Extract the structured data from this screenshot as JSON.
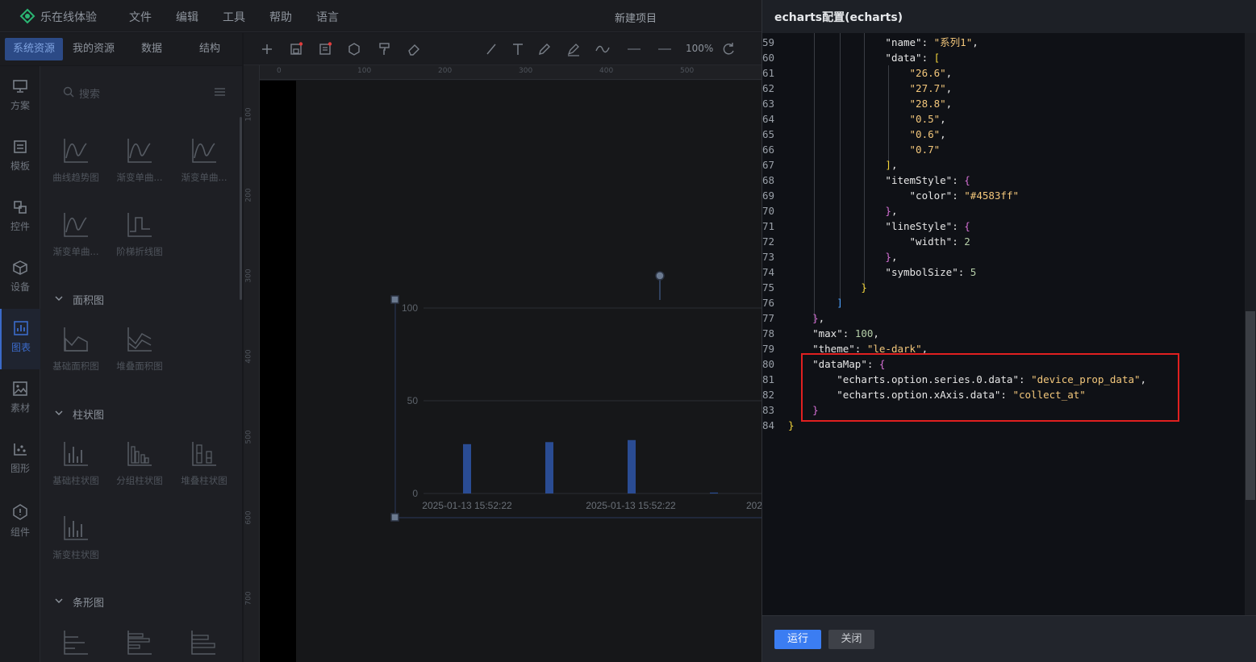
{
  "app": {
    "brand": "乐在线体验",
    "menu": [
      "文件",
      "编辑",
      "工具",
      "帮助",
      "语言"
    ],
    "project_title": "新建项目"
  },
  "left_tabs": [
    {
      "label": "系统资源",
      "active": true
    },
    {
      "label": "我的资源",
      "active": false
    },
    {
      "label": "数据",
      "active": false
    },
    {
      "label": "结构",
      "active": false
    }
  ],
  "rail": [
    {
      "label": "方案",
      "icon": "monitor-icon"
    },
    {
      "label": "模板",
      "icon": "template-icon"
    },
    {
      "label": "控件",
      "icon": "widget-icon"
    },
    {
      "label": "设备",
      "icon": "cube-icon"
    },
    {
      "label": "图表",
      "icon": "chart-icon",
      "active": true
    },
    {
      "label": "素材",
      "icon": "image-icon"
    },
    {
      "label": "图形",
      "icon": "shapes-icon"
    },
    {
      "label": "组件",
      "icon": "component-icon"
    }
  ],
  "library": {
    "search_placeholder": "搜索",
    "line_items": [
      "曲线趋势图",
      "渐变单曲...",
      "渐变单曲...",
      "渐变单曲...",
      "阶梯折线图"
    ],
    "sections": {
      "area": "面积图",
      "bar": "柱状图",
      "hbar": "条形图"
    },
    "area_items": [
      "基础面积图",
      "堆叠面积图"
    ],
    "bar_items": [
      "基础柱状图",
      "分组柱状图",
      "堆叠柱状图",
      "渐变柱状图"
    ]
  },
  "canvas_toolbar": {
    "zoom": "100%"
  },
  "rulers": {
    "h": [
      "0",
      "100",
      "200",
      "300",
      "400",
      "500"
    ],
    "v": [
      "100",
      "200",
      "300",
      "400",
      "500",
      "600",
      "700"
    ]
  },
  "chart_data": {
    "type": "bar",
    "categories": [
      "2025-01-13 15:52:22",
      "2025-01-13 15:52:22",
      "202"
    ],
    "values": [
      26.6,
      27.7,
      28.8,
      0.5
    ],
    "ylim": [
      0,
      100
    ],
    "y_ticks": [
      "100",
      "50",
      "0"
    ],
    "color": "#4583ff"
  },
  "panel": {
    "title": "echarts配置(echarts)",
    "run_label": "运行",
    "close_label": "关闭"
  },
  "code_lines": [
    {
      "n": "59",
      "ind": 4,
      "t": [
        [
          "k",
          "\"name\""
        ],
        [
          "c",
          ": "
        ],
        [
          "s",
          "\"系列1\""
        ],
        [
          "c",
          ","
        ]
      ]
    },
    {
      "n": "60",
      "ind": 4,
      "t": [
        [
          "k",
          "\"data\""
        ],
        [
          "c",
          ": "
        ],
        [
          "p1",
          "["
        ]
      ]
    },
    {
      "n": "61",
      "ind": 5,
      "t": [
        [
          "s",
          "\"26.6\""
        ],
        [
          "c",
          ","
        ]
      ]
    },
    {
      "n": "62",
      "ind": 5,
      "t": [
        [
          "s",
          "\"27.7\""
        ],
        [
          "c",
          ","
        ]
      ]
    },
    {
      "n": "63",
      "ind": 5,
      "t": [
        [
          "s",
          "\"28.8\""
        ],
        [
          "c",
          ","
        ]
      ]
    },
    {
      "n": "64",
      "ind": 5,
      "t": [
        [
          "s",
          "\"0.5\""
        ],
        [
          "c",
          ","
        ]
      ]
    },
    {
      "n": "65",
      "ind": 5,
      "t": [
        [
          "s",
          "\"0.6\""
        ],
        [
          "c",
          ","
        ]
      ]
    },
    {
      "n": "66",
      "ind": 5,
      "t": [
        [
          "s",
          "\"0.7\""
        ]
      ]
    },
    {
      "n": "67",
      "ind": 4,
      "t": [
        [
          "p1",
          "]"
        ],
        [
          "c",
          ","
        ]
      ]
    },
    {
      "n": "68",
      "ind": 4,
      "t": [
        [
          "k",
          "\"itemStyle\""
        ],
        [
          "c",
          ": "
        ],
        [
          "p2",
          "{"
        ]
      ]
    },
    {
      "n": "69",
      "ind": 5,
      "t": [
        [
          "k",
          "\"color\""
        ],
        [
          "c",
          ": "
        ],
        [
          "s",
          "\"#4583ff\""
        ]
      ]
    },
    {
      "n": "70",
      "ind": 4,
      "t": [
        [
          "p2",
          "}"
        ],
        [
          "c",
          ","
        ]
      ]
    },
    {
      "n": "71",
      "ind": 4,
      "t": [
        [
          "k",
          "\"lineStyle\""
        ],
        [
          "c",
          ": "
        ],
        [
          "p2",
          "{"
        ]
      ]
    },
    {
      "n": "72",
      "ind": 5,
      "t": [
        [
          "k",
          "\"width\""
        ],
        [
          "c",
          ": "
        ],
        [
          "n",
          "2"
        ]
      ]
    },
    {
      "n": "73",
      "ind": 4,
      "t": [
        [
          "p2",
          "}"
        ],
        [
          "c",
          ","
        ]
      ]
    },
    {
      "n": "74",
      "ind": 4,
      "t": [
        [
          "k",
          "\"symbolSize\""
        ],
        [
          "c",
          ": "
        ],
        [
          "n",
          "5"
        ]
      ]
    },
    {
      "n": "75",
      "ind": 3,
      "t": [
        [
          "p1",
          "}"
        ]
      ]
    },
    {
      "n": "76",
      "ind": 2,
      "t": [
        [
          "p3",
          "]"
        ]
      ]
    },
    {
      "n": "77",
      "ind": 1,
      "t": [
        [
          "p2",
          "}"
        ],
        [
          "c",
          ","
        ]
      ]
    },
    {
      "n": "78",
      "ind": 1,
      "t": [
        [
          "k",
          "\"max\""
        ],
        [
          "c",
          ": "
        ],
        [
          "n",
          "100"
        ],
        [
          "c",
          ","
        ]
      ]
    },
    {
      "n": "79",
      "ind": 1,
      "t": [
        [
          "k",
          "\"theme\""
        ],
        [
          "c",
          ": "
        ],
        [
          "s",
          "\"le-dark\""
        ],
        [
          "c",
          ","
        ]
      ]
    },
    {
      "n": "80",
      "ind": 1,
      "t": [
        [
          "k",
          "\"dataMap\""
        ],
        [
          "c",
          ": "
        ],
        [
          "p2",
          "{"
        ]
      ]
    },
    {
      "n": "81",
      "ind": 2,
      "t": [
        [
          "k",
          "\"echarts.option.series.0.data\""
        ],
        [
          "c",
          ": "
        ],
        [
          "s",
          "\"device_prop_data\""
        ],
        [
          "c",
          ","
        ]
      ]
    },
    {
      "n": "82",
      "ind": 2,
      "t": [
        [
          "k",
          "\"echarts.option.xAxis.data\""
        ],
        [
          "c",
          ": "
        ],
        [
          "s",
          "\"collect_at\""
        ]
      ]
    },
    {
      "n": "83",
      "ind": 1,
      "t": [
        [
          "p2",
          "}"
        ]
      ]
    },
    {
      "n": "84",
      "ind": 0,
      "t": [
        [
          "p1",
          "}"
        ]
      ]
    }
  ]
}
